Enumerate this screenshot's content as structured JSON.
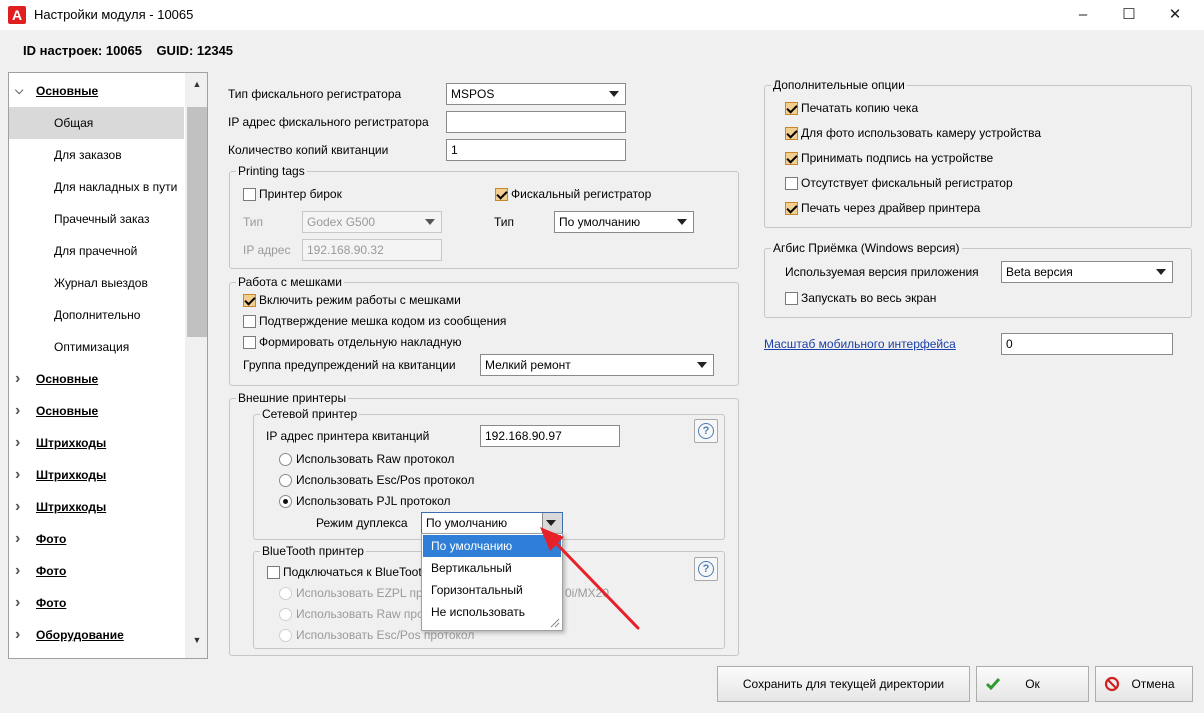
{
  "window": {
    "title": "Настройки модуля - 10065",
    "icon_letter": "A"
  },
  "header": {
    "id_line": "ID настроек: 10065    GUID: 12345"
  },
  "nav": {
    "items": [
      {
        "label": "Основные",
        "level": "top",
        "expanded": true
      },
      {
        "label": "Общая",
        "level": "sub",
        "selected": true
      },
      {
        "label": "Для заказов",
        "level": "sub"
      },
      {
        "label": "Для накладных в пути",
        "level": "sub"
      },
      {
        "label": "Прачечный заказ",
        "level": "sub"
      },
      {
        "label": "Для прачечной",
        "level": "sub"
      },
      {
        "label": "Журнал выездов",
        "level": "sub"
      },
      {
        "label": "Дополнительно",
        "level": "sub"
      },
      {
        "label": "Оптимизация",
        "level": "sub"
      },
      {
        "label": "Основные",
        "level": "top"
      },
      {
        "label": "Основные",
        "level": "top"
      },
      {
        "label": "Штрихкоды",
        "level": "top"
      },
      {
        "label": "Штрихкоды",
        "level": "top"
      },
      {
        "label": "Штрихкоды",
        "level": "top"
      },
      {
        "label": "Фото",
        "level": "top"
      },
      {
        "label": "Фото",
        "level": "top"
      },
      {
        "label": "Фото",
        "level": "top"
      },
      {
        "label": "Оборудование",
        "level": "top"
      }
    ]
  },
  "fiscal": {
    "type_label": "Тип фискального регистратора",
    "type_value": "MSPOS",
    "ip_label": "IP адрес фискального регистратора",
    "ip_value": "",
    "copies_label": "Количество копий квитанции",
    "copies_value": "1"
  },
  "printing_tags": {
    "title": "Printing tags",
    "tag_printer_label": "Принтер бирок",
    "type_label": "Тип",
    "type_value": "Godex G500",
    "ip_label": "IP адрес",
    "ip_value": "192.168.90.32",
    "fiscal_label": "Фискальный регистратор",
    "fiscal_type_label": "Тип",
    "fiscal_type_value": "По умолчанию"
  },
  "bags": {
    "title": "Работа с мешками",
    "enable_label": "Включить режим работы с мешками",
    "confirm_label": "Подтверждение мешка кодом из сообщения",
    "separate_label": "Формировать отдельную накладную",
    "warn_group_label": "Группа предупреждений на квитанции",
    "warn_group_value": "Мелкий ремонт"
  },
  "ext_printers": {
    "title": "Внешние принтеры",
    "network": {
      "title": "Сетевой принтер",
      "ip_label": "IP адрес принтера квитанций",
      "ip_value": "192.168.90.97",
      "raw_label": "Использовать Raw протокол",
      "escpos_label": "Использовать Esc/Pos протокол",
      "pjl_label": "Использовать PJL протокол",
      "duplex_label": "Режим дуплекса",
      "duplex_value": "По умолчанию"
    },
    "bluetooth": {
      "title": "BlueTooth принтер",
      "connect_label": "Подключаться к BlueToot",
      "ezpl_label": "Использовать EZPL про",
      "ezpl_tail": "0i/MX20",
      "raw_label": "Использовать Raw про",
      "escpos_label": "Использовать Esc/Pos протокол"
    },
    "help_symbol": "?"
  },
  "duplex_dropdown": {
    "options": [
      "По умолчанию",
      "Вертикальный",
      "Горизонтальный",
      "Не использовать"
    ]
  },
  "extra": {
    "title": "Дополнительные опции",
    "opt1": "Печатать копию чека",
    "opt2": "Для фото использовать камеру устройства",
    "opt3": "Принимать подпись на устройстве",
    "opt4": "Отсутствует фискальный регистратор",
    "opt5": "Печать через драйвер принтера"
  },
  "agbis": {
    "title": "Агбис Приёмка (Windows версия)",
    "version_label": "Используемая версия приложения",
    "version_value": "Beta версия",
    "fullscreen_label": "Запускать во весь экран"
  },
  "scale": {
    "label": "Масштаб мобильного интерфейса",
    "value": "0"
  },
  "buttons": {
    "save_dir": "Сохранить для текущей директории",
    "ok": "Ок",
    "cancel": "Отмена"
  },
  "colors": {
    "accent_check": "#f3cf8f",
    "selection_blue": "#2f7fd8",
    "arrow_red": "#e8202a"
  }
}
